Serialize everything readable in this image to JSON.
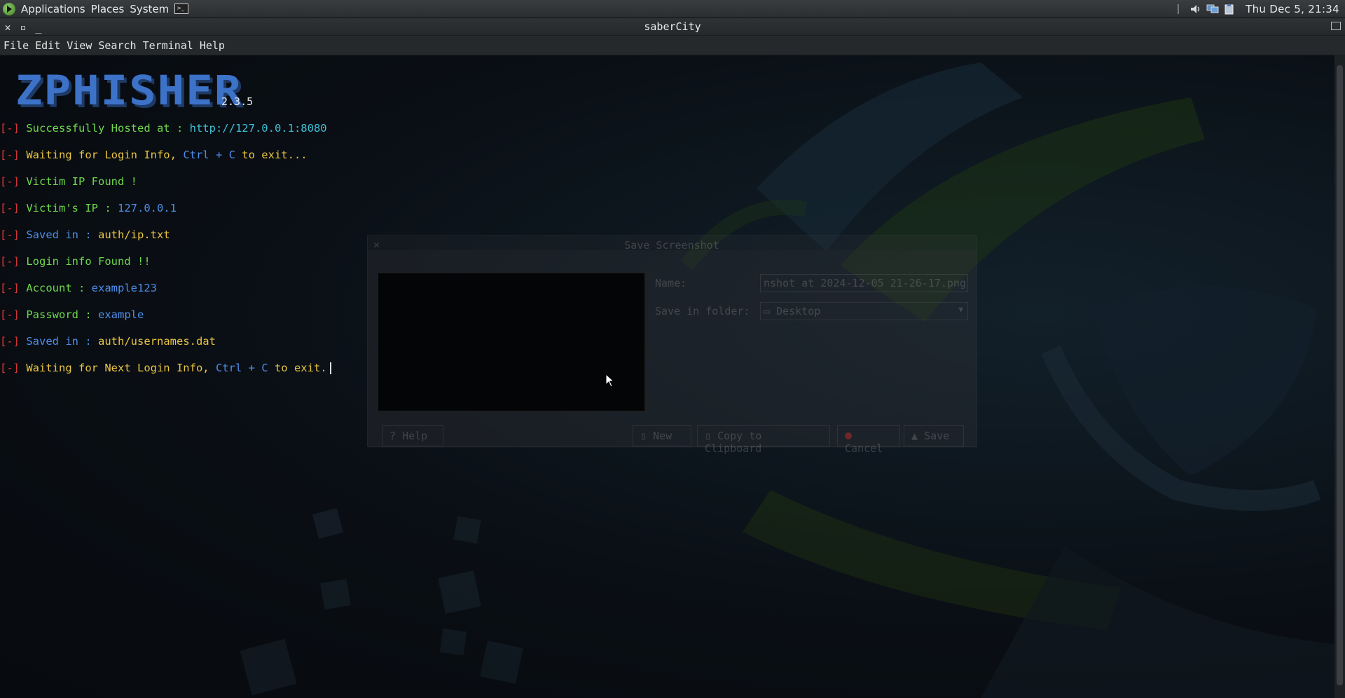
{
  "panel": {
    "menus": [
      "Applications",
      "Places",
      "System"
    ],
    "clock": "Thu Dec  5, 21:34"
  },
  "window": {
    "title": "saberCity"
  },
  "menubar": [
    "File",
    "Edit",
    "View",
    "Search",
    "Terminal",
    "Help"
  ],
  "terminal": {
    "banner": "ZPHISHER",
    "version": "2.3.5",
    "bracket": "[-]",
    "lines": {
      "hosted_label": "Successfully Hosted at : ",
      "hosted_url": "http://127.0.0.1:8080",
      "waiting_a": "Waiting for Login Info, ",
      "waiting_b": "Ctrl + C",
      "waiting_c": " to exit...",
      "victim_found": "Victim IP Found !",
      "victim_ip_label": "Victim's IP : ",
      "victim_ip_value": "127.0.0.1",
      "saved1_label": "Saved in : ",
      "saved1_value": "auth/ip.txt",
      "login_found": "Login info Found !!",
      "account_label": "Account : ",
      "account_value": "example123",
      "password_label": "Password : ",
      "password_value": "example",
      "saved2_label": "Saved in : ",
      "saved2_value": "auth/usernames.dat",
      "next_a": "Waiting for Next Login Info, ",
      "next_b": "Ctrl + C",
      "next_c": " to exit."
    }
  },
  "dialog": {
    "title": "Save Screenshot",
    "name_label": "Name:",
    "name_value": "nshot at 2024-12-05 21-26-17.png",
    "folder_label": "Save in folder:",
    "folder_value": "Desktop",
    "buttons": {
      "help": "Help",
      "new": "New",
      "copy": "Copy to Clipboard",
      "cancel": "Cancel",
      "save": "Save"
    }
  },
  "colors": {
    "bracket_red": "#d83a3a",
    "green": "#6fd84d",
    "yellow": "#e9c542",
    "blue": "#4f8ee8",
    "cyan": "#40c0d6",
    "banner_blue": "#3d72c9"
  }
}
